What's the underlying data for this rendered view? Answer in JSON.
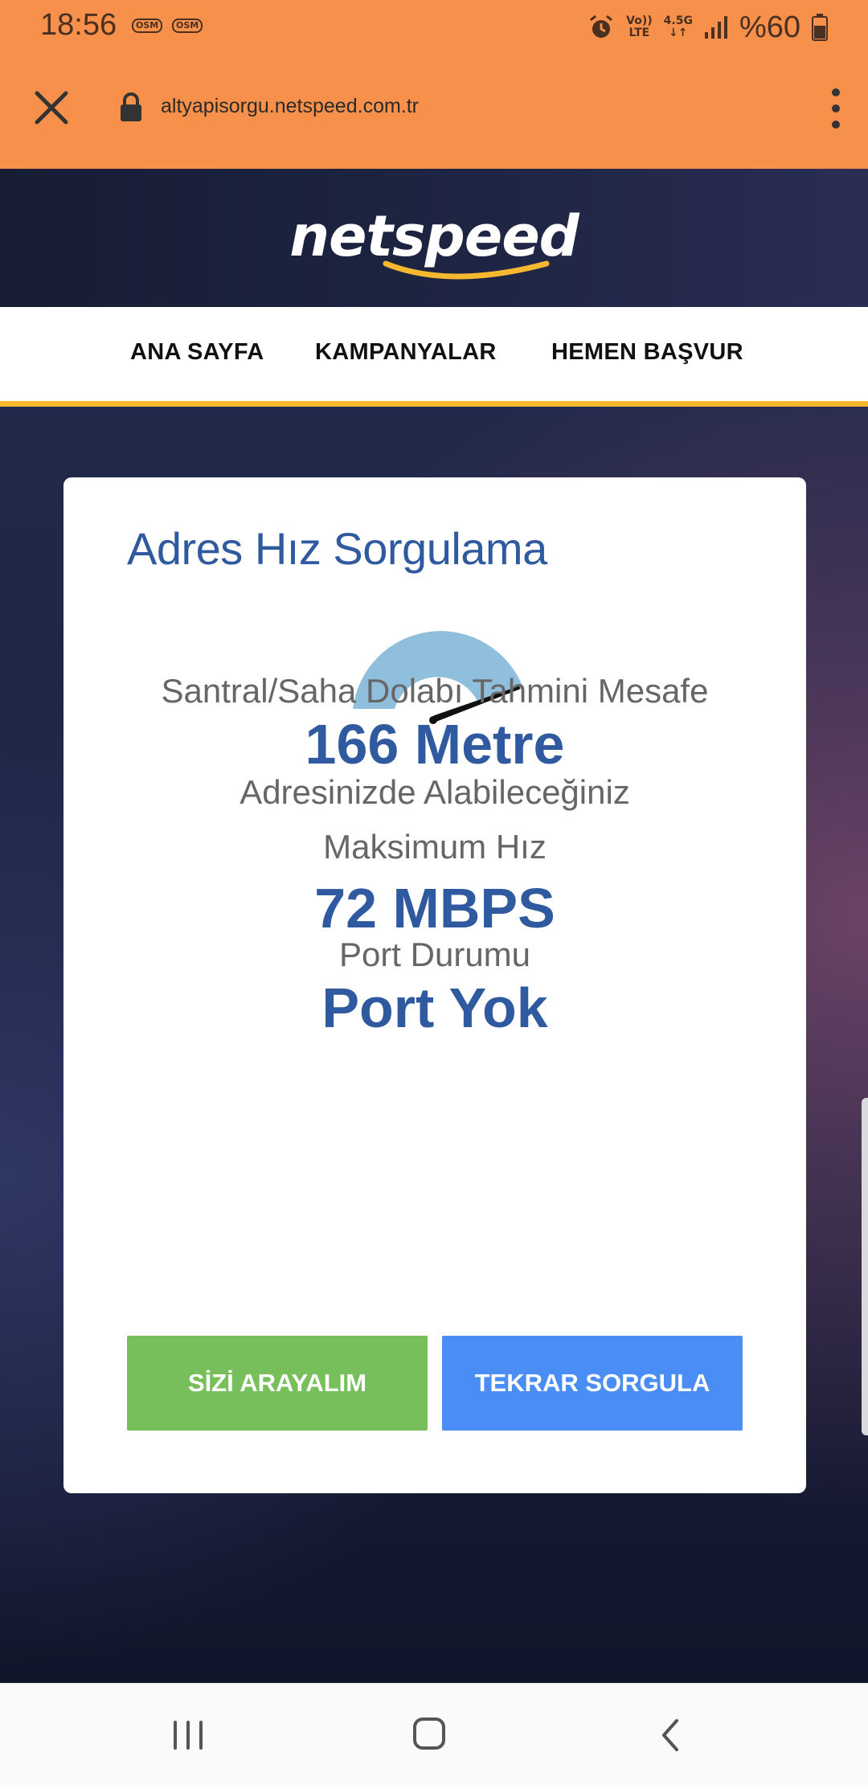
{
  "status_bar": {
    "time": "18:56",
    "carrier_badges": [
      "OSM",
      "OSM"
    ],
    "volte": [
      "Vo))",
      "LTE"
    ],
    "network": "4.5G",
    "battery_text": "%60",
    "icons": [
      "alarm-icon",
      "signal-icon",
      "battery-icon"
    ]
  },
  "browser": {
    "url": "altyapisorgu.netspeed.com.tr",
    "icons": [
      "close-icon",
      "lock-icon",
      "more-vert-icon"
    ]
  },
  "site": {
    "logo_text": "netspeed",
    "nav": [
      "ANA SAYFA",
      "KAMPANYALAR",
      "HEMEN BAŞVUR"
    ]
  },
  "result": {
    "title": "Adres Hız Sorgulama",
    "distance_label": "Santral/Saha Dolabı Tahmini Mesafe",
    "distance_value": "166 Metre",
    "speed_label_line1": "Adresinizde Alabileceğiniz",
    "speed_label_line2": "Maksimum Hız",
    "speed_value": "72 MBPS",
    "port_label": "Port Durumu",
    "port_value": "Port Yok"
  },
  "buttons": {
    "call_me": "SİZİ ARAYALIM",
    "query_again": "TEKRAR SORGULA"
  },
  "colors": {
    "browser_bar": "#f7904a",
    "title_blue": "#2f5aa0",
    "button_green": "#77bf5b",
    "button_blue": "#4a8ef5",
    "nav_underline": "#f5b82e",
    "gauge_fill": "#8fbfdd"
  },
  "system_nav": [
    "recent-apps-icon",
    "home-icon",
    "back-icon"
  ]
}
